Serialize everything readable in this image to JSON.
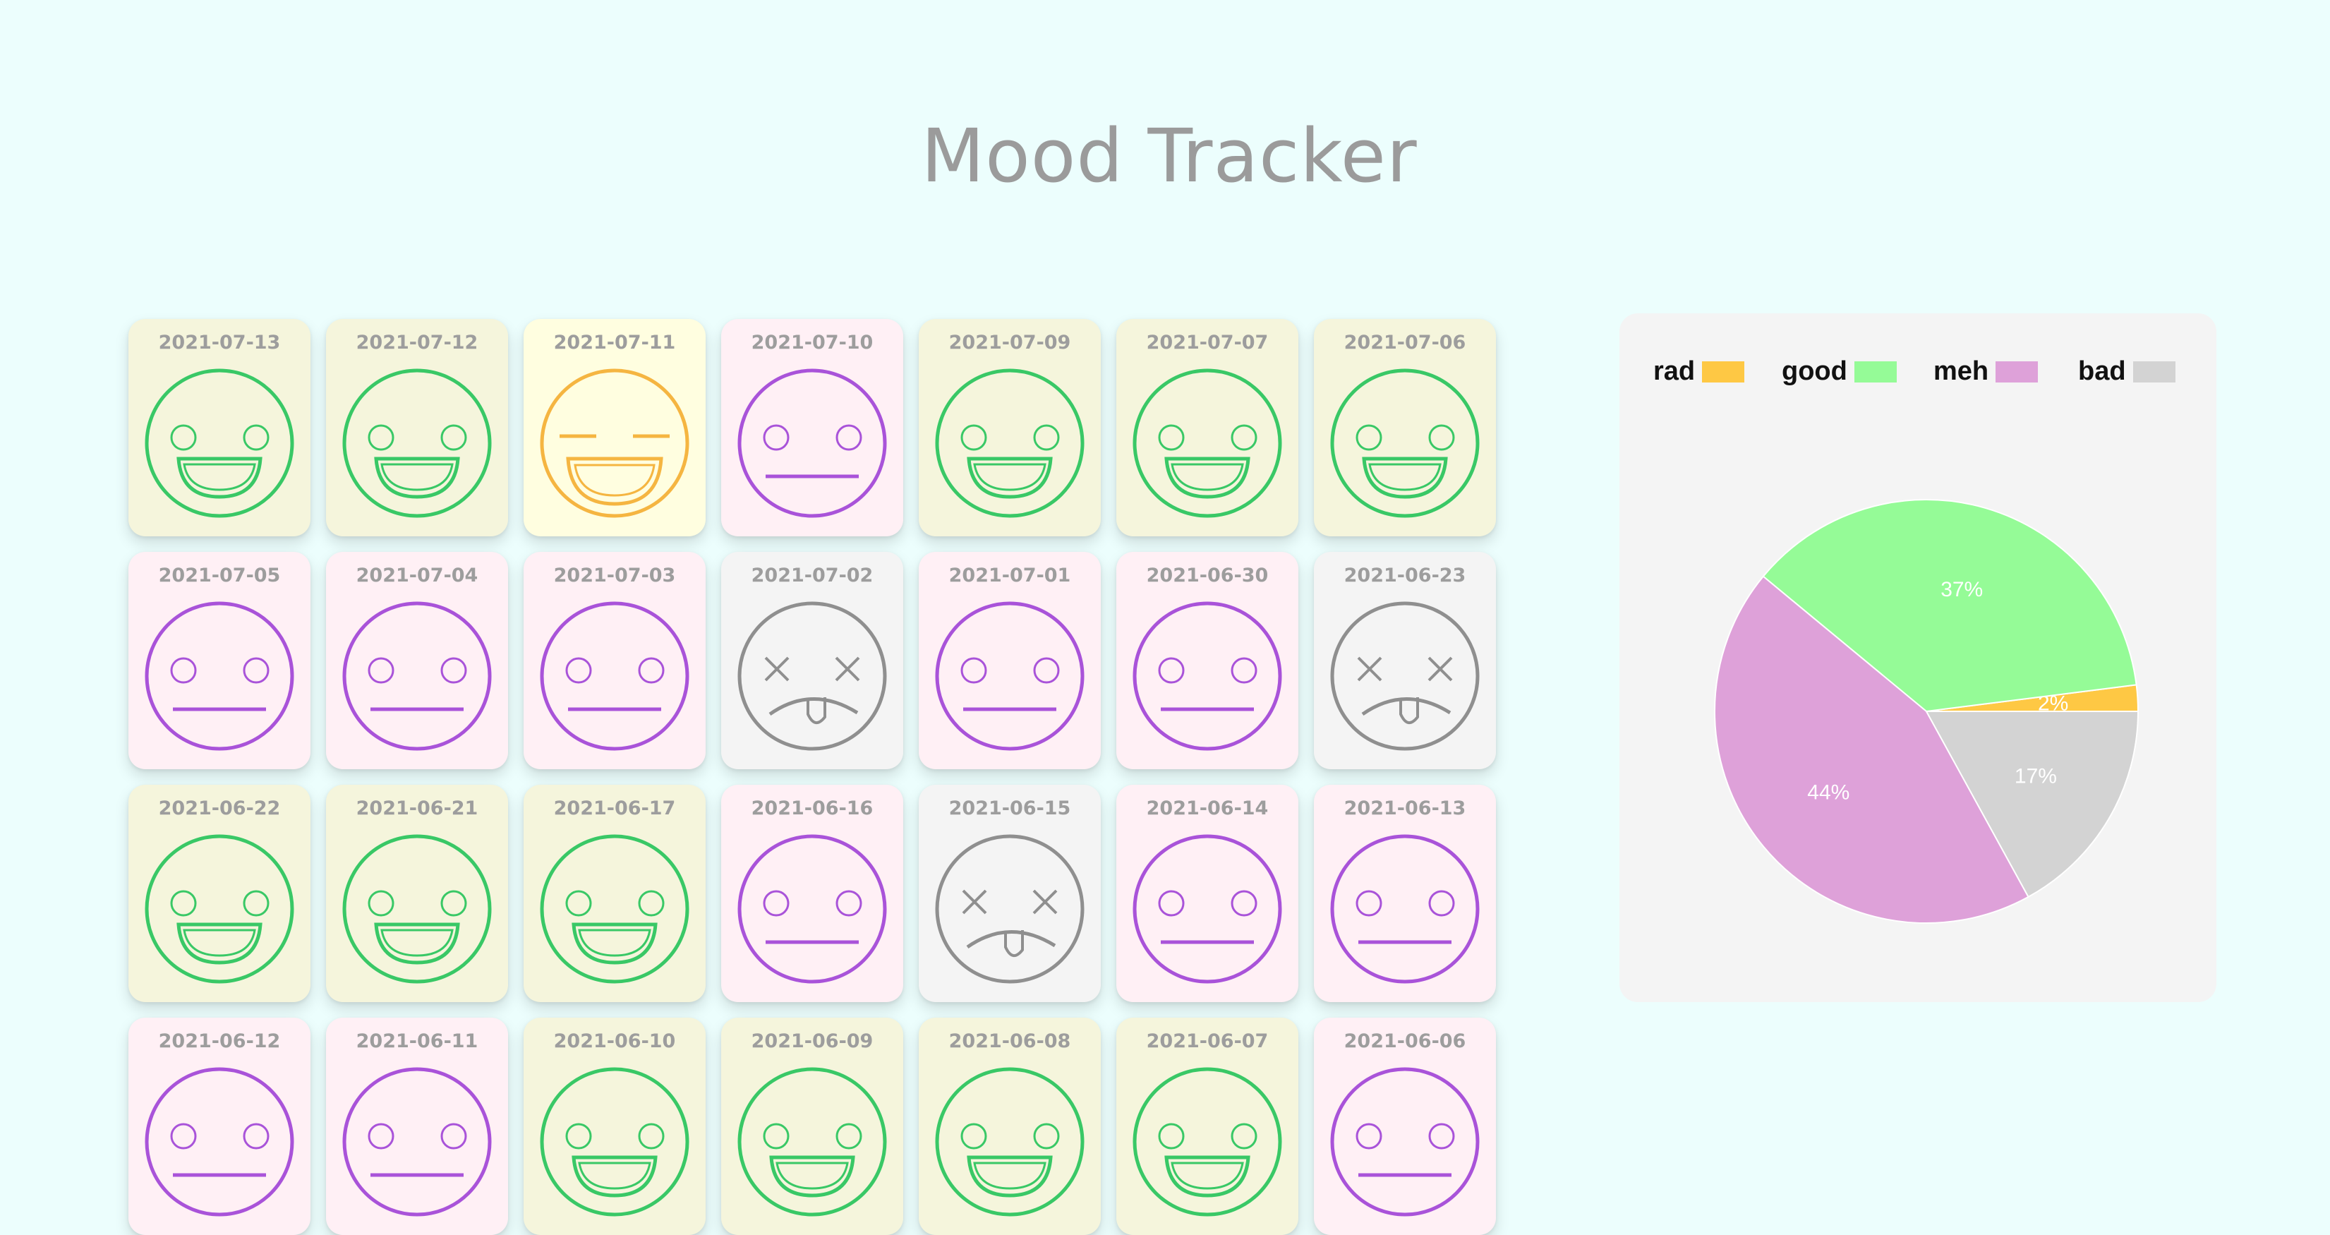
{
  "page": {
    "title": "Mood Tracker"
  },
  "colors": {
    "rad": "#f5b541",
    "good": "#39c866",
    "meh": "#a953d9",
    "bad": "#8f8f8f",
    "card_rad": "#fffee0",
    "card_good": "#f5f5dc",
    "card_meh": "#fff0f5",
    "card_bad": "#f4f4f4"
  },
  "entries": [
    {
      "date": "2021-07-13",
      "mood": "good"
    },
    {
      "date": "2021-07-12",
      "mood": "good"
    },
    {
      "date": "2021-07-11",
      "mood": "rad"
    },
    {
      "date": "2021-07-10",
      "mood": "meh"
    },
    {
      "date": "2021-07-09",
      "mood": "good"
    },
    {
      "date": "2021-07-07",
      "mood": "good"
    },
    {
      "date": "2021-07-06",
      "mood": "good"
    },
    {
      "date": "2021-07-05",
      "mood": "meh"
    },
    {
      "date": "2021-07-04",
      "mood": "meh"
    },
    {
      "date": "2021-07-03",
      "mood": "meh"
    },
    {
      "date": "2021-07-02",
      "mood": "bad"
    },
    {
      "date": "2021-07-01",
      "mood": "meh"
    },
    {
      "date": "2021-06-30",
      "mood": "meh"
    },
    {
      "date": "2021-06-23",
      "mood": "bad"
    },
    {
      "date": "2021-06-22",
      "mood": "good"
    },
    {
      "date": "2021-06-21",
      "mood": "good"
    },
    {
      "date": "2021-06-17",
      "mood": "good"
    },
    {
      "date": "2021-06-16",
      "mood": "meh"
    },
    {
      "date": "2021-06-15",
      "mood": "bad"
    },
    {
      "date": "2021-06-14",
      "mood": "meh"
    },
    {
      "date": "2021-06-13",
      "mood": "meh"
    },
    {
      "date": "2021-06-12",
      "mood": "meh"
    },
    {
      "date": "2021-06-11",
      "mood": "meh"
    },
    {
      "date": "2021-06-10",
      "mood": "good"
    },
    {
      "date": "2021-06-09",
      "mood": "good"
    },
    {
      "date": "2021-06-08",
      "mood": "good"
    },
    {
      "date": "2021-06-07",
      "mood": "good"
    },
    {
      "date": "2021-06-06",
      "mood": "meh"
    }
  ],
  "legend": [
    {
      "label": "rad",
      "color": "#fec844"
    },
    {
      "label": "good",
      "color": "#95fb97"
    },
    {
      "label": "meh",
      "color": "#dea1d9"
    },
    {
      "label": "bad",
      "color": "#d3d3d3"
    }
  ],
  "chart_data": {
    "type": "pie",
    "categories": [
      "rad",
      "good",
      "meh",
      "bad"
    ],
    "values": [
      2,
      37,
      44,
      17
    ],
    "labels": [
      "2%",
      "37%",
      "44%",
      "17%"
    ],
    "colors": [
      "#fec844",
      "#95fb97",
      "#dea1d9",
      "#d3d3d3"
    ],
    "legend_position": "top"
  }
}
